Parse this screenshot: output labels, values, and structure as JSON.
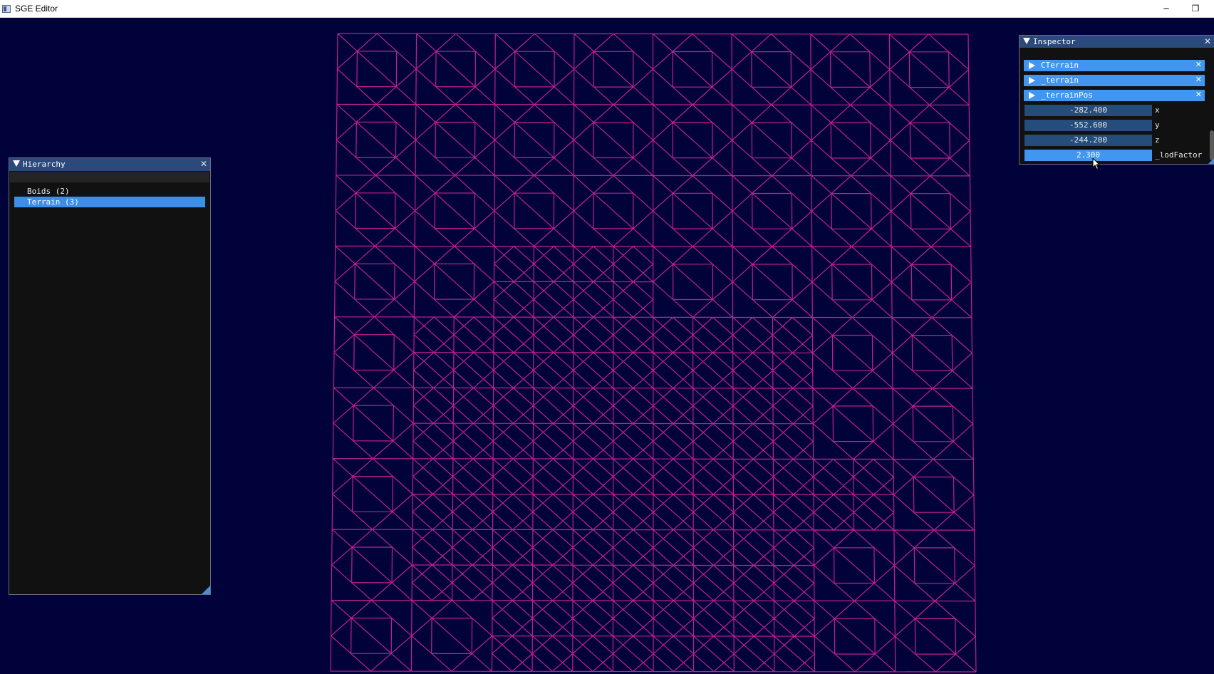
{
  "window": {
    "title": "SGE Editor",
    "minimize_glyph": "─",
    "restore_glyph": "❐"
  },
  "hierarchy": {
    "title": "Hierarchy",
    "close_glyph": "✕",
    "items": [
      {
        "label": "Boids (2)",
        "selected": false
      },
      {
        "label": "Terrain (3)",
        "selected": true
      }
    ]
  },
  "inspector": {
    "title": "Inspector",
    "close_glyph": "✕",
    "headers": [
      {
        "label": "CTerrain",
        "close_glyph": "✕"
      },
      {
        "label": "_terrain",
        "close_glyph": "✕"
      },
      {
        "label": "_terrainPos",
        "close_glyph": "✕"
      }
    ],
    "fields": [
      {
        "value": "-282.400",
        "label": "x",
        "active": false
      },
      {
        "value": "-552.600",
        "label": "y",
        "active": false
      },
      {
        "value": "-244.200",
        "label": "z",
        "active": false
      },
      {
        "value": "2.300",
        "label": "_lodFactor",
        "active": true
      }
    ]
  },
  "colors": {
    "background": "#02023a",
    "wireframe": "#c0208f",
    "accent": "#4096f0",
    "panel": "#111111"
  },
  "icons": {
    "app": "app-window-icon",
    "tree_arrow": "collapse-triangle-icon",
    "header_arrow": "expand-triangle-icon",
    "cursor": "mouse-cursor-icon"
  }
}
